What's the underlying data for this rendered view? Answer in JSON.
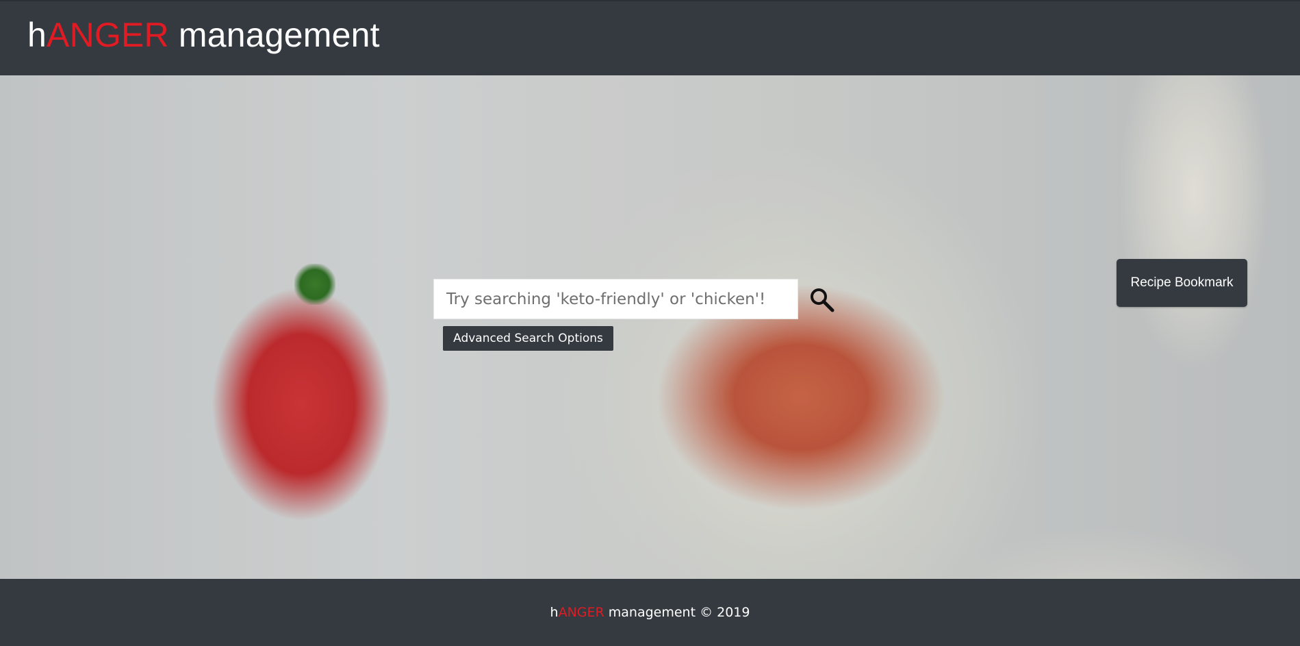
{
  "header": {
    "brand_prefix": "h",
    "brand_accent": "ANGER",
    "brand_suffix": " management"
  },
  "hero": {
    "search": {
      "placeholder": "Try searching 'keto-friendly' or 'chicken'!",
      "icon": "search-icon"
    },
    "advanced_search_label": "Advanced Search Options",
    "bookmark_label": "Recipe Bookmark"
  },
  "footer": {
    "brand_prefix": "h",
    "brand_accent": "ANGER",
    "rest": " management © 2019"
  },
  "colors": {
    "nav_bg": "#343a40",
    "accent_red": "#e11b23",
    "text_white": "#ffffff"
  }
}
